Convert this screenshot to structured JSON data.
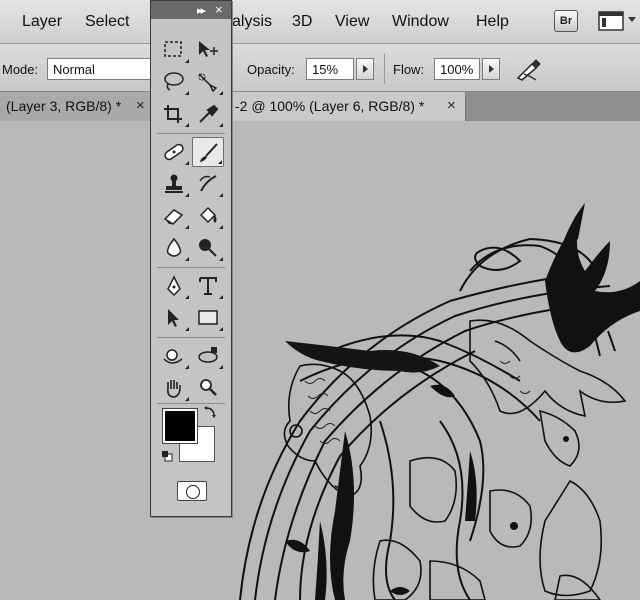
{
  "menubar": {
    "items": [
      "Layer",
      "Select",
      "alysis",
      "3D",
      "View",
      "Window",
      "Help"
    ],
    "bridge_badge": "Br",
    "icons": [
      "screen-mode-icon"
    ]
  },
  "options": {
    "mode_label": "Mode:",
    "mode_value": "Normal",
    "opacity_label": "Opacity:",
    "opacity_value": "15%",
    "flow_label": "Flow:",
    "flow_value": "100%"
  },
  "tabs": [
    {
      "label": "(Layer 3, RGB/8) *",
      "close": "×"
    },
    {
      "label": "-2 @ 100% (Layer 6, RGB/8) *",
      "close": "×"
    }
  ],
  "tools_panel": {
    "collapse": "▸▸",
    "close": "×",
    "tools": [
      "marquee-tool",
      "move-tool",
      "lasso-tool",
      "quick-selection-tool",
      "crop-tool",
      "eyedropper-tool",
      "healing-brush-tool",
      "brush-tool",
      "clone-stamp-tool",
      "history-brush-tool",
      "eraser-tool",
      "paint-bucket-tool",
      "blur-tool",
      "dodge-tool",
      "pen-tool",
      "type-tool",
      "path-selection-tool",
      "rectangle-tool",
      "3d-rotate-tool",
      "3d-orbit-tool",
      "hand-tool",
      "zoom-tool"
    ],
    "active_tool": "brush-tool",
    "foreground_color": "#000000",
    "background_color": "#ffffff"
  }
}
